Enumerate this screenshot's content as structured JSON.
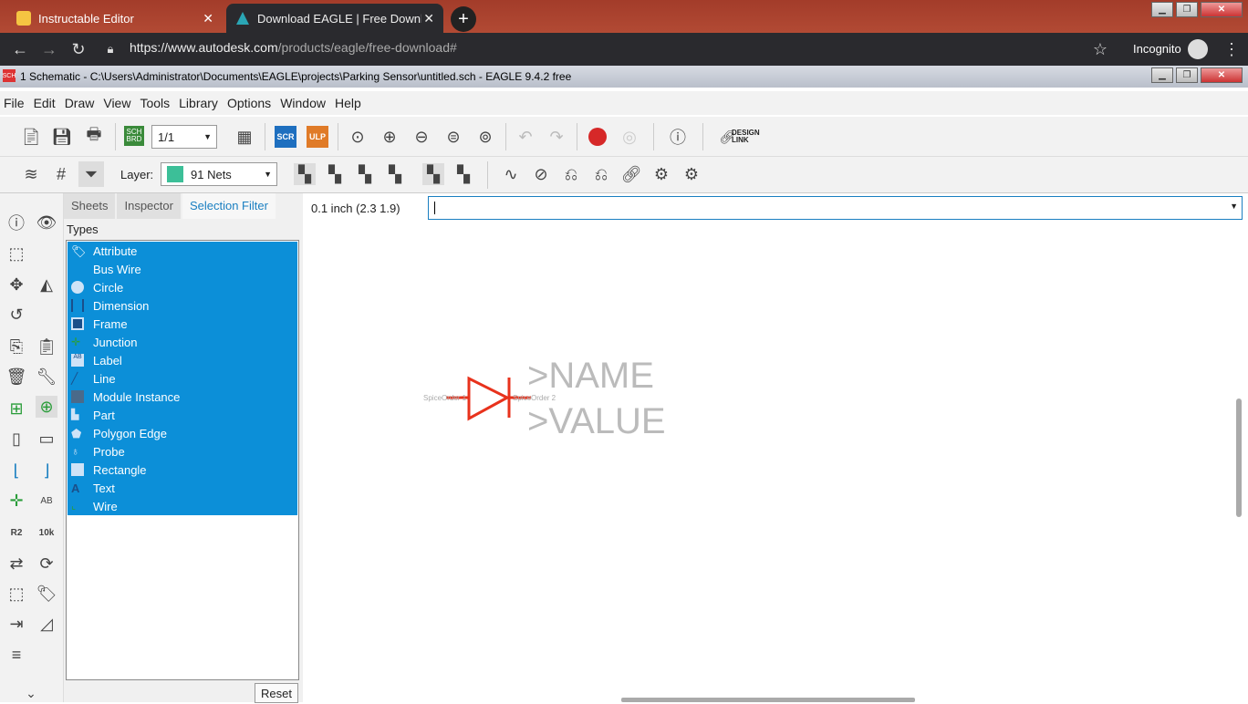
{
  "browser": {
    "tabs": [
      {
        "title": "Instructable Editor",
        "active": false
      },
      {
        "title": "Download EAGLE | Free Downloa",
        "active": true
      }
    ],
    "url_main": "https://www.autodesk.com",
    "url_path": "/products/eagle/free-download#",
    "mode_label": "Incognito"
  },
  "eagle": {
    "title": "1 Schematic - C:\\Users\\Administrator\\Documents\\EAGLE\\projects\\Parking Sensor\\untitled.sch - EAGLE 9.4.2 free",
    "menu": [
      "File",
      "Edit",
      "Draw",
      "View",
      "Tools",
      "Library",
      "Options",
      "Window",
      "Help"
    ],
    "sheet_select": "1/1",
    "scr_label": "SCR",
    "ulp_label": "ULP",
    "sch_brd_label": "SCH BRD",
    "design_link": "DESIGN LINK",
    "layer_label": "Layer:",
    "layer_value": "91 Nets",
    "layer_color": "#3cbf98"
  },
  "panel": {
    "tabs": [
      "Sheets",
      "Inspector",
      "Selection Filter"
    ],
    "types_label": "Types",
    "types": [
      "Attribute",
      "Bus Wire",
      "Circle",
      "Dimension",
      "Frame",
      "Junction",
      "Label",
      "Line",
      "Module Instance",
      "Part",
      "Polygon Edge",
      "Probe",
      "Rectangle",
      "Text",
      "Wire"
    ],
    "reset_label": "Reset"
  },
  "command": {
    "coord": "0.1 inch (2.3 1.9)",
    "input_value": ""
  },
  "canvas": {
    "name_text": ">NAME",
    "value_text": ">VALUE",
    "pin_left": "SpiceOrder 1",
    "pin_right": "SpiceOrder 2",
    "symbol_color": "#e8321c"
  }
}
